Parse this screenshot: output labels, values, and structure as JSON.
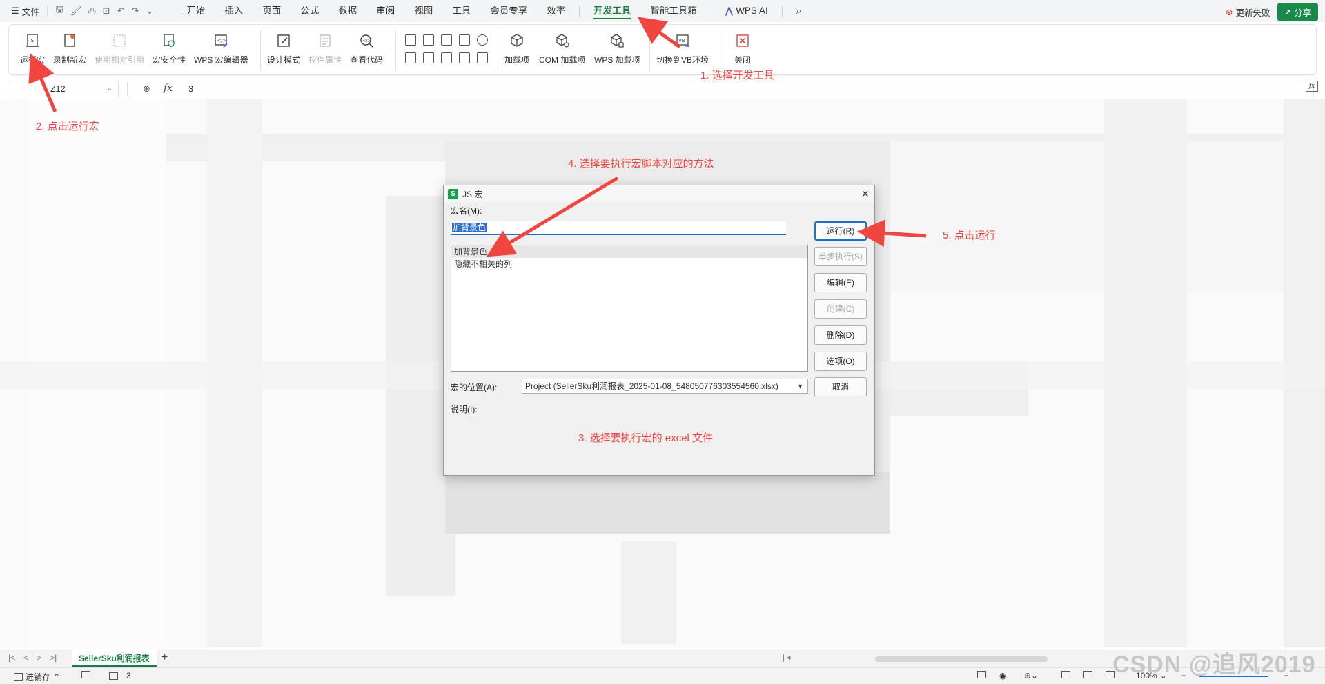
{
  "menubar": {
    "file_label": "文件",
    "tabs": [
      "开始",
      "插入",
      "页面",
      "公式",
      "数据",
      "审阅",
      "视图",
      "工具",
      "会员专享",
      "效率",
      "开发工具",
      "智能工具箱",
      "WPS AI"
    ],
    "update_fail": "更新失败",
    "share": "分享"
  },
  "ribbon": {
    "run_macro": "运行宏",
    "record_macro": "录制新宏",
    "relative_ref": "使用相对引用",
    "macro_security": "宏安全性",
    "wps_macro_editor": "WPS 宏编辑器",
    "design_mode": "设计模式",
    "control_props": "控件属性",
    "view_code": "查看代码",
    "addins": "加载项",
    "com_addins": "COM 加载项",
    "wps_addins": "WPS 加载项",
    "switch_vb": "切换到VB环境",
    "close": "关闭"
  },
  "formula": {
    "cell_ref": "Z12",
    "value": "3"
  },
  "annotations": {
    "a1": "1. 选择开发工具",
    "a2": "2. 点击运行宏",
    "a3": "3. 选择要执行宏的 excel 文件",
    "a4": "4. 选择要执行宏脚本对应的方法",
    "a5": "5. 点击运行"
  },
  "dialog": {
    "title": "JS 宏",
    "macro_name_label": "宏名(M):",
    "macro_name_value": "加背景色",
    "list_items": [
      "加背景色",
      "隐藏不相关的列"
    ],
    "buttons": {
      "run": "运行(R)",
      "step": "单步执行(S)",
      "edit": "编辑(E)",
      "create": "创建(C)",
      "delete": "删除(D)",
      "options": "选项(O)",
      "cancel": "取消"
    },
    "location_label": "宏的位置(A):",
    "location_value": "Project (SellerSku利润报表_2025-01-08_548050776303554560.xlsx)",
    "description_label": "说明(I):"
  },
  "sheet": {
    "tab_name": "SellerSku利润报表"
  },
  "statusbar": {
    "left_label": "进销存",
    "count": "3",
    "zoom": "100%"
  },
  "watermark": "CSDN @追风2019",
  "colors": {
    "accent": "#1a7a43",
    "annotation": "#f0463f",
    "selection": "#2b6fd6"
  }
}
